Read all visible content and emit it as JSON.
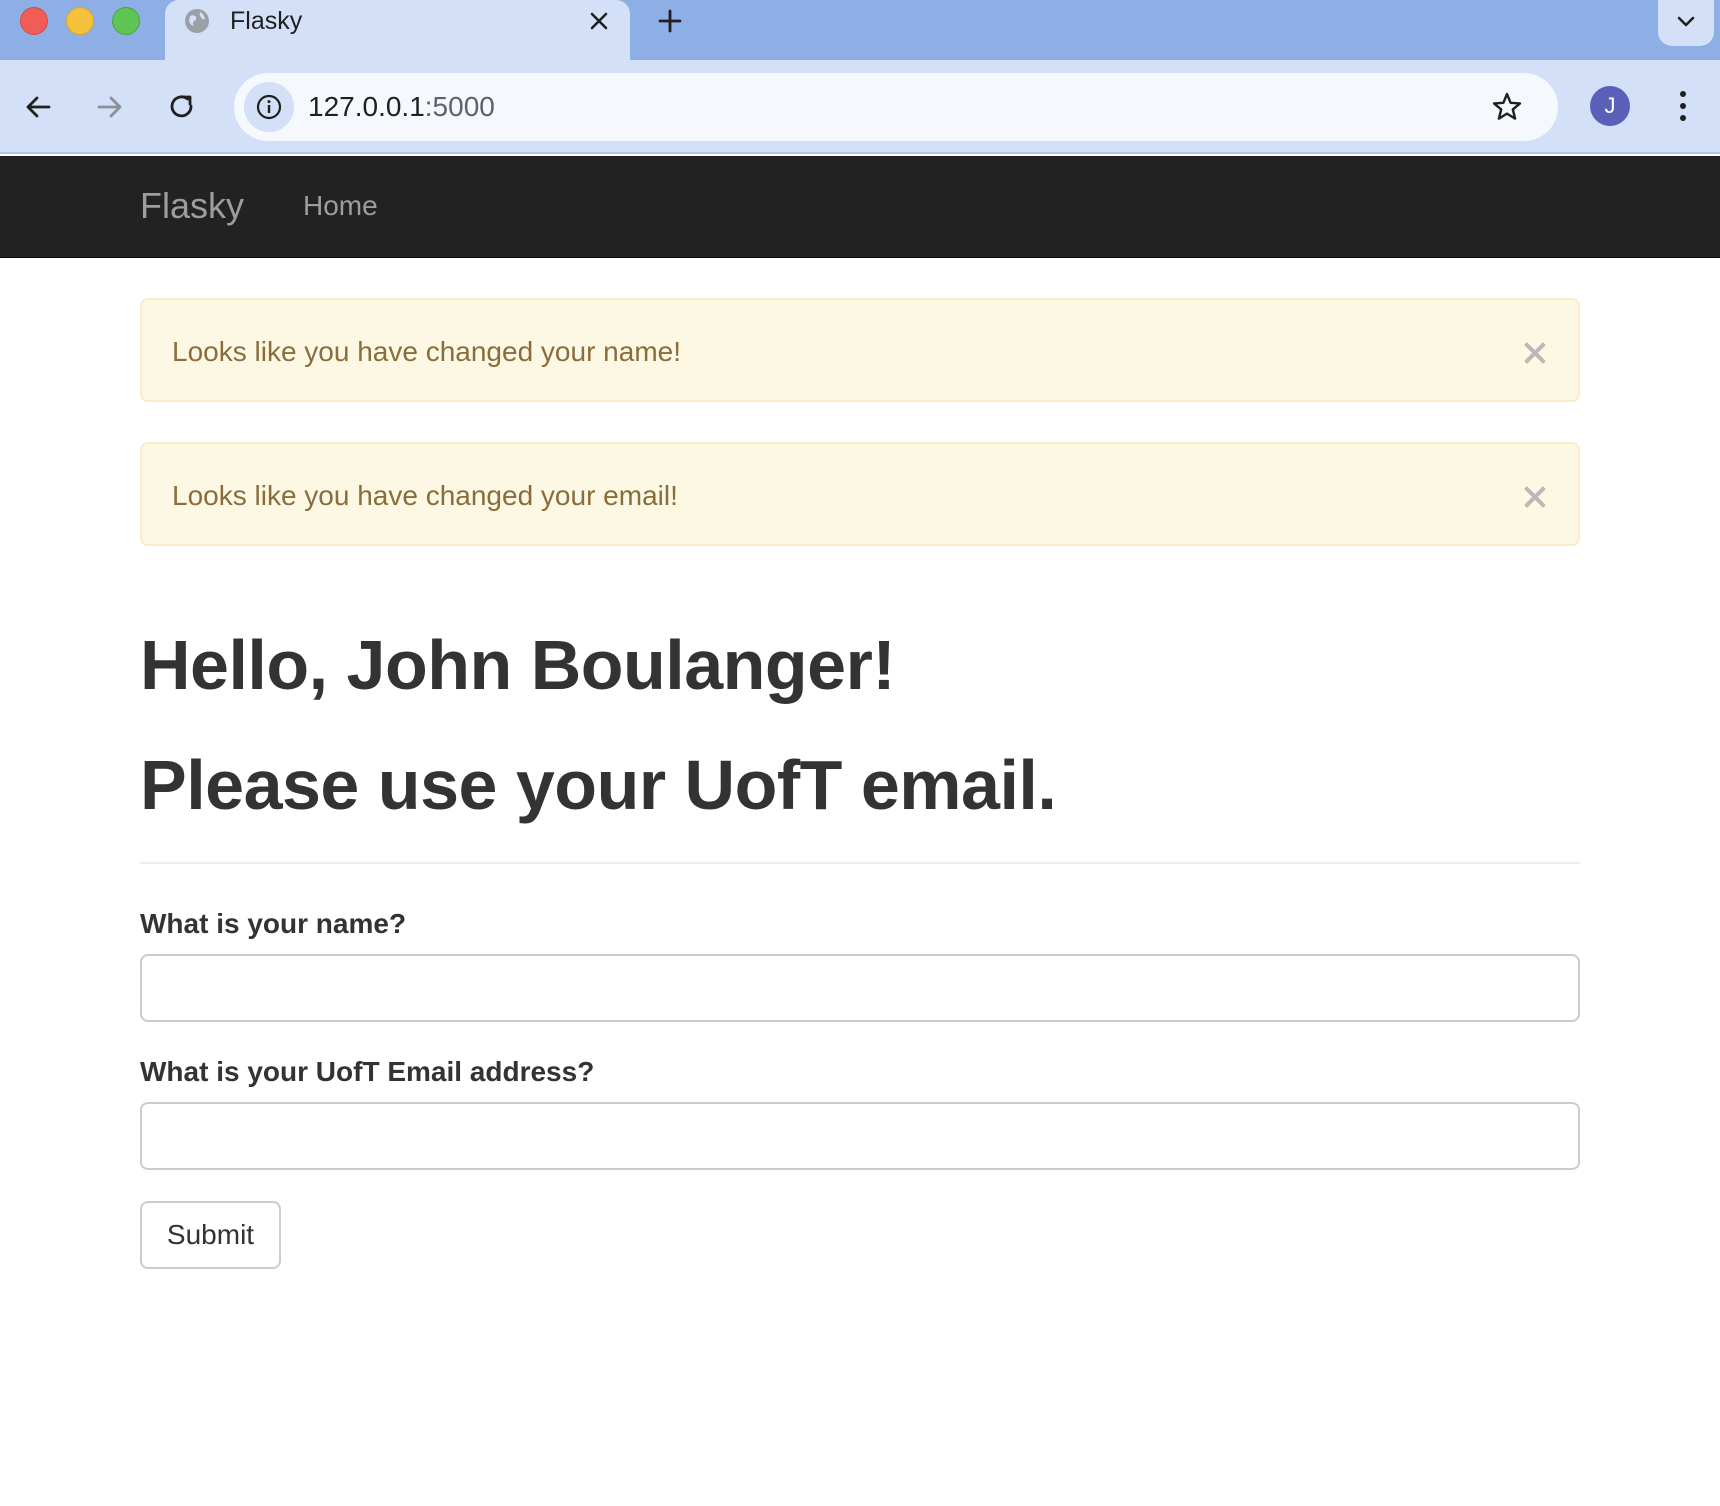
{
  "browser": {
    "tab": {
      "title": "Flasky"
    },
    "address_bar": {
      "host": "127.0.0.1",
      "port": ":5000"
    },
    "profile": {
      "initial": "J",
      "color": "#5a5fb8"
    },
    "colors": {
      "tabstrip": "#8eaee6",
      "toolbar": "#d3e0f7"
    }
  },
  "navbar": {
    "brand": "Flasky",
    "links": [
      {
        "label": "Home"
      }
    ],
    "color": "#222222"
  },
  "alerts": [
    {
      "message": "Looks like you have changed your name!",
      "close_icon": "close-icon"
    },
    {
      "message": "Looks like you have changed your email!",
      "close_icon": "close-icon"
    }
  ],
  "alert_colors": {
    "background": "#fcf8e3",
    "text": "#8a6d3b",
    "border": "#faebcc"
  },
  "page_header": {
    "greeting": "Hello, John Boulanger!",
    "notice": "Please use your UofT email."
  },
  "form": {
    "name_label": "What is your name?",
    "name_value": "",
    "email_label": "What is your UofT Email address?",
    "email_value": "",
    "submit_label": "Submit"
  }
}
